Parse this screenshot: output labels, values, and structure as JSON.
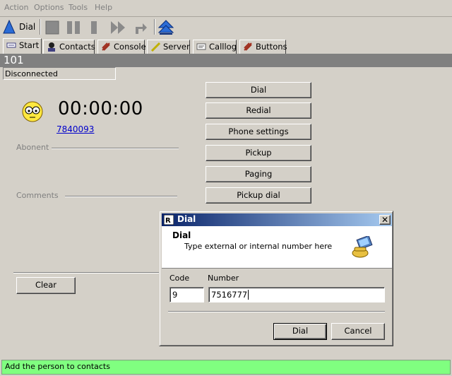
{
  "menu": [
    "Action",
    "Options",
    "Tools",
    "Help"
  ],
  "toolbar": {
    "dial_label": "Dial"
  },
  "tabs": [
    {
      "label": "Start",
      "icon": "start-icon"
    },
    {
      "label": "Contacts",
      "icon": "contacts-icon"
    },
    {
      "label": "Console",
      "icon": "console-icon"
    },
    {
      "label": "Server",
      "icon": "server-icon"
    },
    {
      "label": "Calllog",
      "icon": "calllog-icon"
    },
    {
      "label": "Buttons",
      "icon": "buttons-icon"
    }
  ],
  "extension": "101",
  "connection_status": "Disconnected",
  "call": {
    "timer": "00:00:00",
    "number": "7840093"
  },
  "labels": {
    "abonent": "Abonent",
    "comments": "Comments"
  },
  "action_buttons": [
    "Dial",
    "Redial",
    "Phone settings",
    "Pickup",
    "Paging",
    "Pickup dial"
  ],
  "clear_label": "Clear",
  "dialog": {
    "title": "Dial",
    "heading": "Dial",
    "subtitle": "Type external or internal number here",
    "code_label": "Code",
    "number_label": "Number",
    "code_value": "9",
    "number_value": "7516777",
    "dial_button": "Dial",
    "cancel_button": "Cancel"
  },
  "statusbar_text": "Add the person to contacts",
  "colors": {
    "statusbar": "#80ff80",
    "title_start": "#0a246a",
    "title_end": "#a6caf0",
    "extbar": "#808080"
  }
}
